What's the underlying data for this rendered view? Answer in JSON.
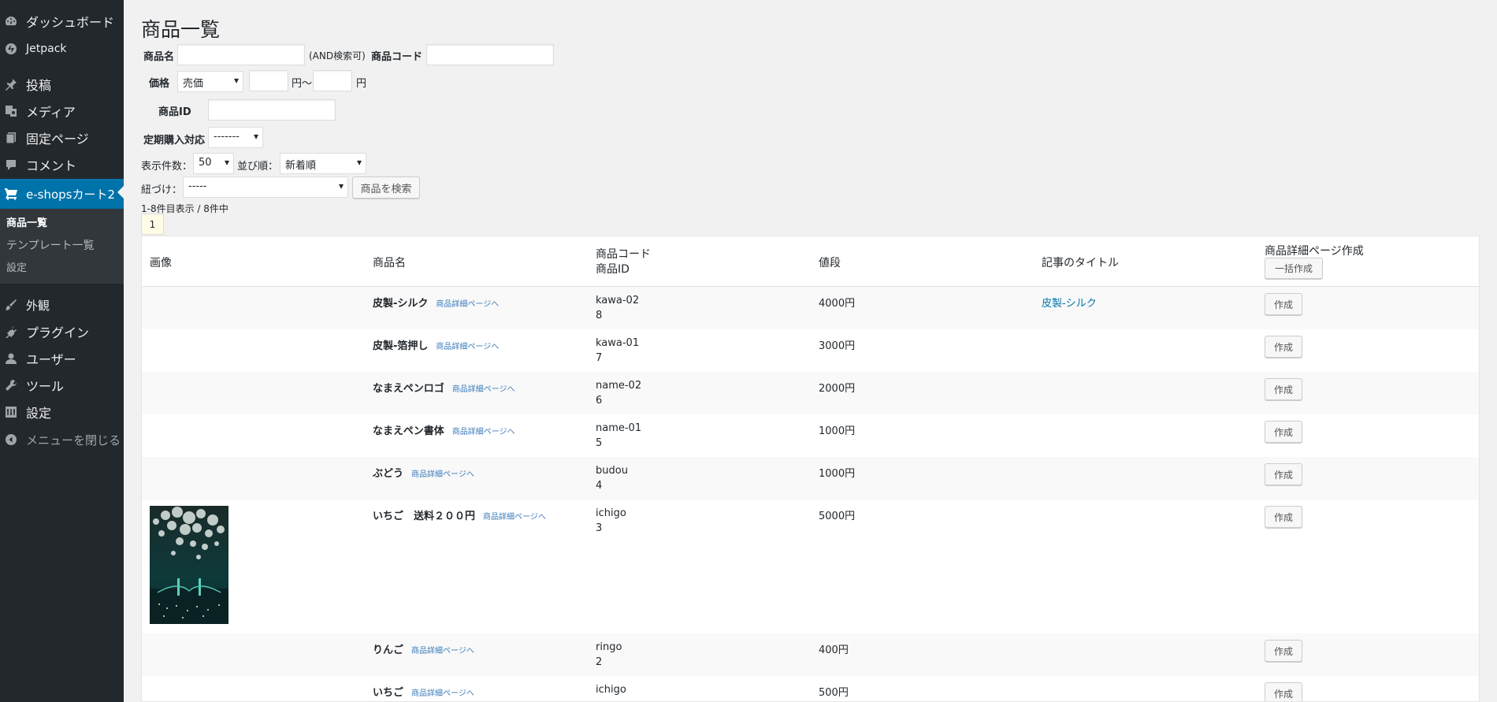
{
  "sidebar": {
    "items": [
      {
        "label": "ダッシュボード",
        "icon": "dashboard-icon"
      },
      {
        "label": "Jetpack",
        "icon": "jetpack-icon"
      },
      {
        "label": "投稿",
        "icon": "pin-icon"
      },
      {
        "label": "メディア",
        "icon": "media-icon"
      },
      {
        "label": "固定ページ",
        "icon": "page-icon"
      },
      {
        "label": "コメント",
        "icon": "comment-icon"
      },
      {
        "label": "e-shopsカート2",
        "icon": "cart-icon"
      },
      {
        "label": "外観",
        "icon": "brush-icon"
      },
      {
        "label": "プラグイン",
        "icon": "plugin-icon"
      },
      {
        "label": "ユーザー",
        "icon": "user-icon"
      },
      {
        "label": "ツール",
        "icon": "wrench-icon"
      },
      {
        "label": "設定",
        "icon": "settings-icon"
      },
      {
        "label": "メニューを閉じる",
        "icon": "collapse-icon"
      }
    ],
    "submenu": [
      "商品一覧",
      "テンプレート一覧",
      "設定"
    ]
  },
  "page": {
    "title": "商品一覧"
  },
  "search": {
    "name_label": "商品名",
    "name_value": "",
    "and_hint": "(AND検索可)",
    "code_label": "商品コード",
    "code_value": "",
    "price_label": "価格",
    "price_type": "売価",
    "price_min": "",
    "yen_tilde": "円〜",
    "price_max": "",
    "yen": "円",
    "id_label": "商品ID",
    "id_value": "",
    "subscription_label": "定期購入対応",
    "subscription_value": "-------",
    "per_page_label": "表示件数：",
    "per_page_value": "50",
    "sort_label": "並び順：",
    "sort_value": "新着順",
    "link_label": "紐づけ：",
    "link_value": "-----",
    "search_button": "商品を検索",
    "result_count": "1-8件目表示 / 8件中",
    "current_page": "1"
  },
  "table": {
    "headers": {
      "image": "画像",
      "name": "商品名",
      "code": "商品コード",
      "id": "商品ID",
      "price": "値段",
      "article": "記事のタイトル",
      "detail": "商品詳細ページ作成",
      "bulk_button": "一括作成"
    },
    "detail_link": "商品詳細ページへ",
    "make_button": "作成",
    "rows": [
      {
        "name": "皮製-シルク",
        "code": "kawa-02",
        "id": "8",
        "price": "4000円",
        "article": "皮製-シルク"
      },
      {
        "name": "皮製-箔押し",
        "code": "kawa-01",
        "id": "7",
        "price": "3000円",
        "article": ""
      },
      {
        "name": "なまえペンロゴ",
        "code": "name-02",
        "id": "6",
        "price": "2000円",
        "article": ""
      },
      {
        "name": "なまえペン書体",
        "code": "name-01",
        "id": "5",
        "price": "1000円",
        "article": ""
      },
      {
        "name": "ぶどう",
        "code": "budou",
        "id": "4",
        "price": "1000円",
        "article": ""
      },
      {
        "name": "いちご　送料２００円",
        "code": "ichigo",
        "id": "3",
        "price": "5000円",
        "article": ""
      },
      {
        "name": "りんご",
        "code": "ringo",
        "id": "2",
        "price": "400円",
        "article": ""
      },
      {
        "name": "いちご",
        "code": "ichigo",
        "id": "",
        "price": "500円",
        "article": ""
      }
    ]
  }
}
